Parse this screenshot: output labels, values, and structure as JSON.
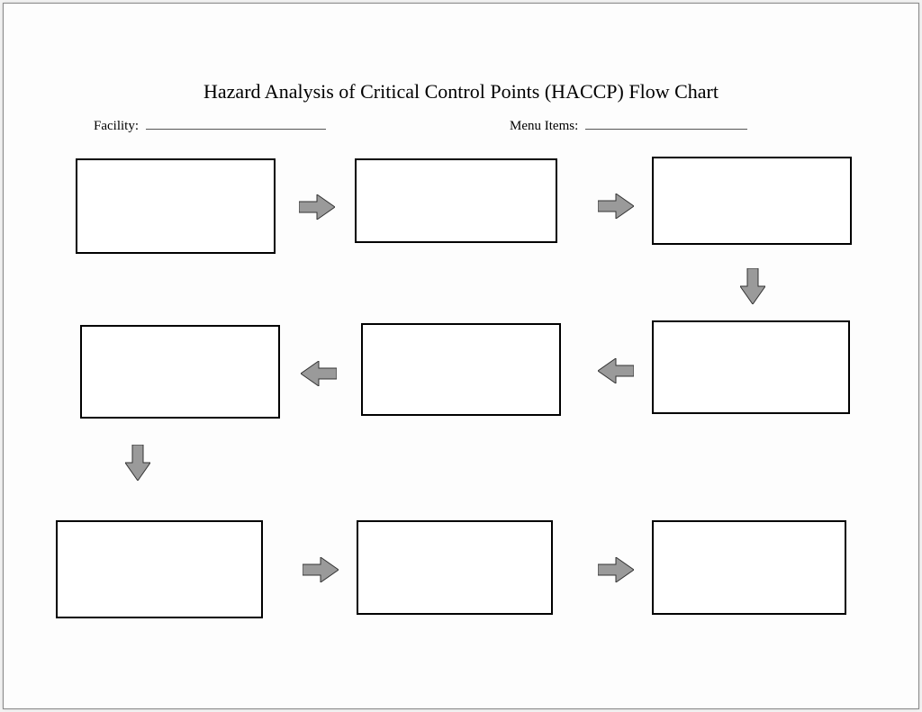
{
  "title": "Hazard Analysis of Critical Control Points (HACCP) Flow Chart",
  "fields": {
    "facility_label": "Facility:",
    "menu_label": "Menu Items:"
  },
  "boxes": [
    "",
    "",
    "",
    "",
    "",
    "",
    "",
    "",
    ""
  ]
}
